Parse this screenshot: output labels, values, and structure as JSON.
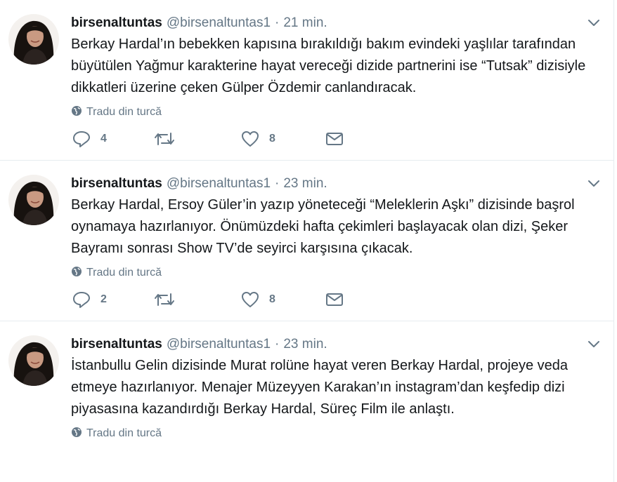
{
  "tweets": [
    {
      "name": "birsenaltuntas",
      "handle": "@birsenaltuntas1",
      "separator": "·",
      "time": "21 min.",
      "text": "Berkay Hardal’ın bebekken kapısına bırakıldığı bakım evindeki yaşlılar tarafından büyütülen Yağmur karakterine hayat vereceği dizide partnerini ise “Tutsak” dizisiyle dikkatleri üzerine çeken Gülper Özdemir canlandıracak.",
      "translate": "Tradu din turcă",
      "replies": "4",
      "retweets": "",
      "likes": "8"
    },
    {
      "name": "birsenaltuntas",
      "handle": "@birsenaltuntas1",
      "separator": "·",
      "time": "23 min.",
      "text": "Berkay Hardal, Ersoy Güler’in yazıp yöneteceği “Meleklerin Aşkı” dizisinde başrol oynamaya hazırlanıyor. Önümüzdeki hafta çekimleri başlayacak olan dizi, Şeker Bayramı sonrası Show TV’de seyirci karşısına çıkacak.",
      "translate": "Tradu din turcă",
      "replies": "2",
      "retweets": "",
      "likes": "8"
    },
    {
      "name": "birsenaltuntas",
      "handle": "@birsenaltuntas1",
      "separator": "·",
      "time": "23 min.",
      "text": "İstanbullu Gelin dizisinde Murat rolüne hayat veren Berkay Hardal, projeye veda etmeye hazırlanıyor. Menajer Müzeyyen Karakan’ın instagram’dan keşfedip dizi piyasasına kazandırdığı Berkay Hardal, Süreç Film ile anlaştı.",
      "translate": "Tradu din turcă",
      "replies": "",
      "retweets": "",
      "likes": ""
    }
  ],
  "icons": {
    "reply": "reply-icon",
    "retweet": "retweet-icon",
    "like": "heart-icon",
    "dm": "envelope-icon",
    "globe": "globe-icon",
    "caret": "chevron-down-icon"
  },
  "colors": {
    "text": "#14171a",
    "muted": "#657786",
    "border": "#e6ecf0"
  }
}
